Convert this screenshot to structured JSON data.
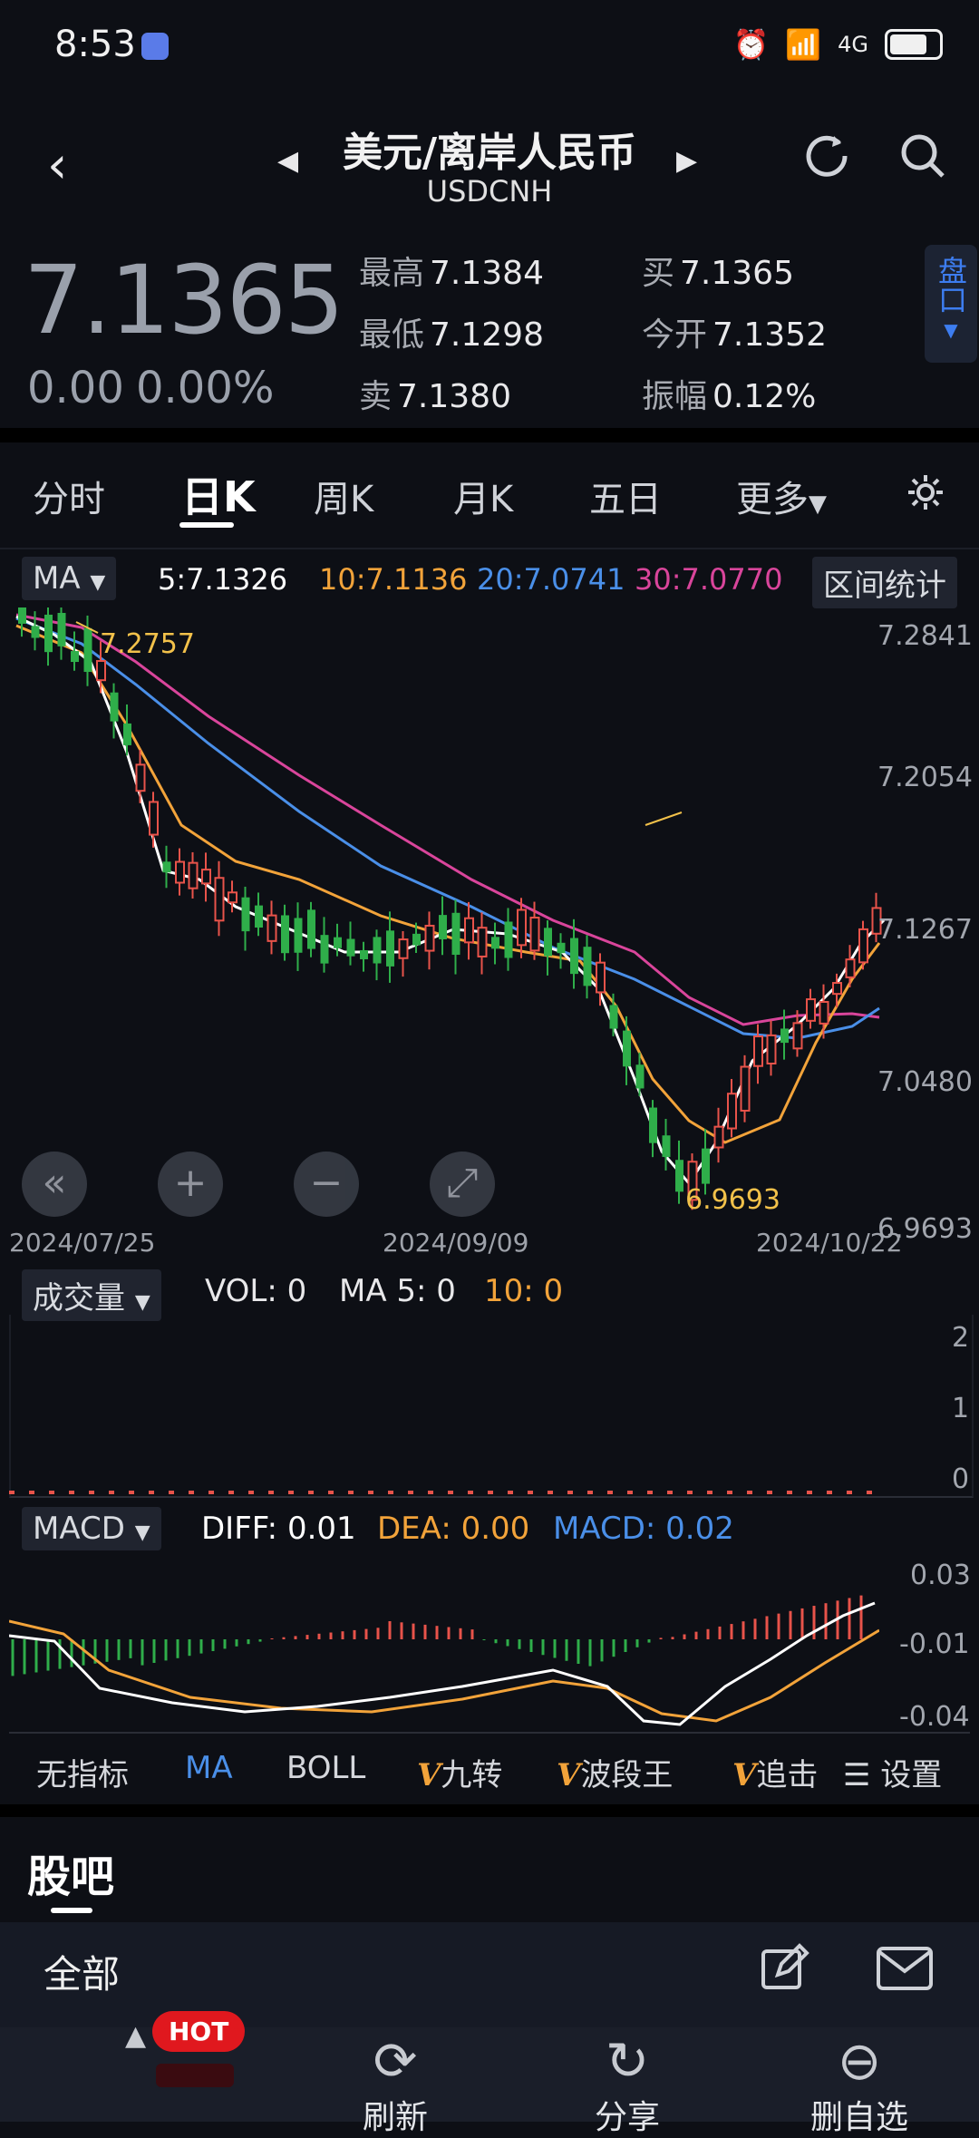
{
  "status_bar": {
    "time": "8:53",
    "network": "4G"
  },
  "header": {
    "title": "美元/离岸人民币",
    "subtitle": "USDCNH"
  },
  "quote": {
    "price": "7.1365",
    "change": "0.00",
    "change_pct": "0.00%",
    "high_label": "最高",
    "high": "7.1384",
    "low_label": "最低",
    "low": "7.1298",
    "sell_label": "卖",
    "sell": "7.1380",
    "buy_label": "买",
    "buy": "7.1365",
    "open_label": "今开",
    "open": "7.1352",
    "amp_label": "振幅",
    "amp": "0.12%",
    "pankou": "盘口"
  },
  "tabs": [
    "分时",
    "日K",
    "周K",
    "月K",
    "五日",
    "更多"
  ],
  "ma_bar": {
    "selector": "MA",
    "ma5": "5:7.1326",
    "ma10": "10:7.1136",
    "ma20": "20:7.0741",
    "ma30": "30:7.0770",
    "range_stats": "区间统计"
  },
  "colors": {
    "up": "#e8534a",
    "down": "#2fae4a",
    "ma5": "#ffffff",
    "ma10": "#f2a33a",
    "ma20": "#4a8fe8",
    "ma30": "#d9459b"
  },
  "kline": {
    "y_axis": [
      "7.2841",
      "7.2054",
      "7.1267",
      "7.0480",
      "6.9693"
    ],
    "dates": [
      "2024/07/25",
      "2024/09/09",
      "2024/10/22"
    ],
    "max_label": "7.2757",
    "min_label": "6.9693",
    "ylim": [
      6.9693,
      7.2841
    ]
  },
  "volume": {
    "selector": "成交量",
    "vol": "VOL: 0",
    "ma5": "MA 5: 0",
    "ma10": "10: 0",
    "y_axis": [
      "2",
      "1",
      "0"
    ]
  },
  "macd": {
    "selector": "MACD",
    "diff": "DIFF: 0.01",
    "dea": "DEA: 0.00",
    "macd": "MACD: 0.02",
    "y_axis": [
      "0.03",
      "-0.01",
      "-0.04"
    ]
  },
  "indicator_tabs": {
    "none": "无指标",
    "ma": "MA",
    "boll": "BOLL",
    "v": "V",
    "nine": "九转",
    "wave": "波段王",
    "chase": "追击",
    "settings": "设置"
  },
  "guba": {
    "title": "股吧",
    "all": "全部"
  },
  "bottom_nav": {
    "hot": "HOT",
    "refresh": "刷新",
    "share": "分享",
    "remove": "删自选"
  }
}
